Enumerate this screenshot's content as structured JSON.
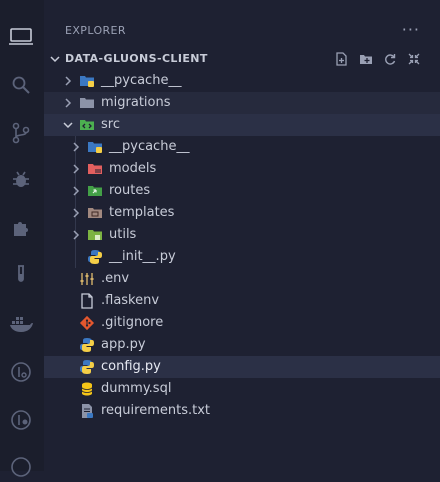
{
  "explorer": {
    "title": "EXPLORER",
    "more": "···"
  },
  "project": {
    "name": "DATA-GLUONS-CLIENT"
  },
  "tree": [
    {
      "label": "__pycache__"
    },
    {
      "label": "migrations"
    },
    {
      "label": "src"
    },
    {
      "label": "__pycache__"
    },
    {
      "label": "models"
    },
    {
      "label": "routes"
    },
    {
      "label": "templates"
    },
    {
      "label": "utils"
    },
    {
      "label": "__init__.py"
    },
    {
      "label": ".env"
    },
    {
      "label": ".flaskenv"
    },
    {
      "label": ".gitignore"
    },
    {
      "label": "app.py"
    },
    {
      "label": "config.py"
    },
    {
      "label": "dummy.sql"
    },
    {
      "label": "requirements.txt"
    }
  ],
  "colors": {
    "background": "#1e2132",
    "activity_bar": "#1b1e2c",
    "selected_row": "#2b3046",
    "text": "#c8ccd8",
    "python_blue": "#3b78c2",
    "python_yellow": "#f5cf47",
    "git_orange": "#e4572e"
  }
}
